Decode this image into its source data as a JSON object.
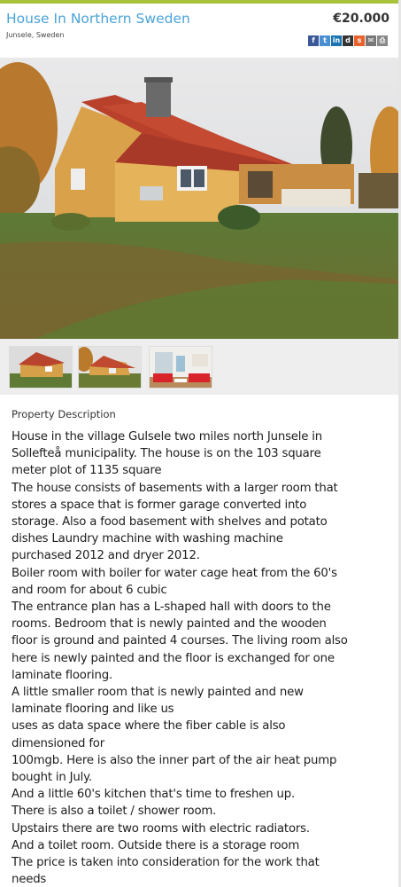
{
  "listing": {
    "title": "House In Northern Sweden",
    "location": "Junsele, Sweden",
    "price": "€20.000"
  },
  "share_icons": [
    {
      "name": "facebook-icon",
      "glyph": "f",
      "color": "#3b5998"
    },
    {
      "name": "twitter-icon",
      "glyph": "t",
      "color": "#4a8fd2"
    },
    {
      "name": "linkedin-icon",
      "glyph": "in",
      "color": "#1a74b0"
    },
    {
      "name": "digg-icon",
      "glyph": "d",
      "color": "#333333"
    },
    {
      "name": "stumbleupon-icon",
      "glyph": "s",
      "color": "#e8622c"
    },
    {
      "name": "email-icon",
      "glyph": "✉",
      "color": "#777777"
    },
    {
      "name": "print-icon",
      "glyph": "⎙",
      "color": "#888888"
    }
  ],
  "gallery": {
    "main_image": "yellow-house-with-red-roof",
    "thumbnails": [
      "house-exterior-1",
      "house-exterior-2",
      "living-room-interior"
    ]
  },
  "description": {
    "label": "Property Description",
    "lines": [
      "House in the village Gulsele two miles north Junsele in",
      "Sollefteå municipality. The house is on the 103 square",
      "meter plot of 1135 square",
      "The house consists of basements with a larger room that",
      "stores a space that is former garage converted into",
      "storage. Also a food basement with shelves and potato",
      "dishes Laundry machine with washing machine",
      "purchased 2012 and dryer 2012.",
      "Boiler room with boiler for water cage heat from the 60's",
      "and room for about 6 cubic",
      "The entrance plan has a L-shaped hall with doors to the",
      "rooms. Bedroom that is newly painted and the wooden",
      "floor is ground and painted 4 courses. The living room also",
      "here is newly painted and the floor is exchanged for one",
      "laminate flooring.",
      "A little smaller room that is newly painted and new",
      "laminate flooring and like us",
      "uses as data space where the fiber cable is also",
      "dimensioned for",
      "100mgb. Here is also the inner part of the air heat pump",
      "bought in July.",
      "And a little 60's kitchen that's time to freshen up.",
      "There is also a toilet / shower room.",
      "Upstairs there are two rooms with electric radiators.",
      "And a toilet room. Outside there is a storage room",
      "The price is taken into consideration for the work that",
      "needs"
    ]
  },
  "colors": {
    "accent_bar": "#a9c23c",
    "title": "#4aa3d8"
  }
}
